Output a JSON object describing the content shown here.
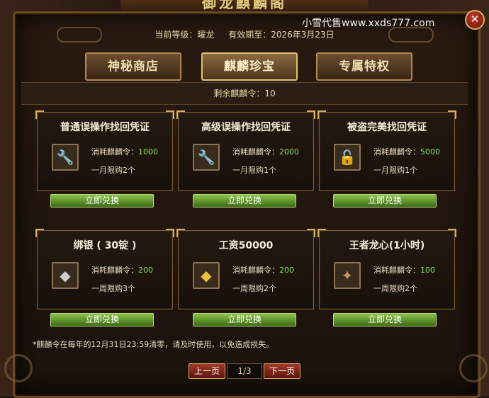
{
  "window": {
    "title": "御龙麒麟阁"
  },
  "watermark": "小雪代售www.xxds777.com",
  "header": {
    "level_label": "当前等级：曜龙",
    "expiry_label": "有效期至：2026年3月23日"
  },
  "tabs": [
    {
      "label": "神秘商店",
      "active": false
    },
    {
      "label": "麒麟珍宝",
      "active": true
    },
    {
      "label": "专属特权",
      "active": false
    }
  ],
  "remaining": "剩余麒麟令：10",
  "cards": [
    {
      "title": "普通误操作找回凭证",
      "icon": "wrench-icon",
      "cost_label": "消耗麒麟令：",
      "cost": "1000",
      "limit": "一月限购2个",
      "button": "立即兑换"
    },
    {
      "title": "高级误操作找回凭证",
      "icon": "wrench-icon",
      "cost_label": "消耗麒麟令：",
      "cost": "2000",
      "limit": "一月限购1个",
      "button": "立即兑换"
    },
    {
      "title": "被盗完美找回凭证",
      "icon": "lock-icon",
      "cost_label": "消耗麒麟令：",
      "cost": "5000",
      "limit": "一月限购1个",
      "button": "立即兑换"
    },
    {
      "title": "绑银 ( 30锭 )",
      "icon": "silver-ingot-icon",
      "cost_label": "消耗麒麟令：",
      "cost": "200",
      "limit": "一周限购3个",
      "button": "立即兑换"
    },
    {
      "title": "工资50000",
      "icon": "gold-ingot-icon",
      "cost_label": "消耗麒麟令：",
      "cost": "200",
      "limit": "一周限购2个",
      "button": "立即兑换"
    },
    {
      "title": "王者龙心(1小时)",
      "icon": "dragon-head-icon",
      "cost_label": "消耗麒麟令：",
      "cost": "100",
      "limit": "一周限购2个",
      "button": "立即兑换"
    }
  ],
  "footnote": "*麒麟令在每年的12月31日23:59清零，请及时使用，以免造成损失。",
  "pager": {
    "prev": "上一页",
    "page": "1/3",
    "next": "下一页"
  },
  "colors": {
    "accent_gold": "#d6b060",
    "cost_green": "#7fe05a",
    "button_green": "#6a9c2e",
    "page_red": "#a23a2a"
  }
}
